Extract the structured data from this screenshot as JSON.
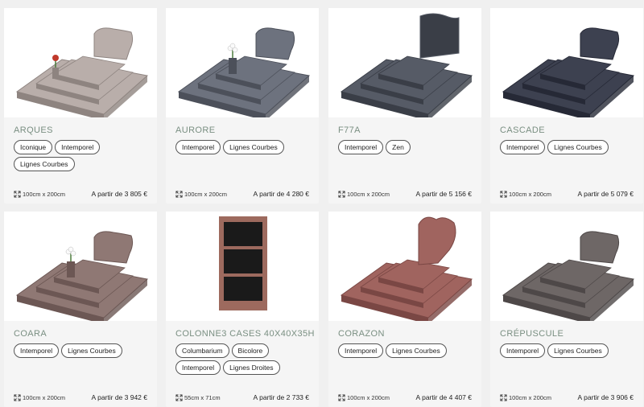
{
  "products": [
    {
      "name": "ARQUES",
      "tags": [
        "Iconique",
        "Intemporel",
        "Lignes Courbes"
      ],
      "dims": "100cm x 200cm",
      "price": "A partir de 3 805 €",
      "stone": "#b9aeaa",
      "stone_dark": "#8e8480",
      "stele": "heart",
      "decor": "rose"
    },
    {
      "name": "AURORE",
      "tags": [
        "Intemporel",
        "Lignes Courbes"
      ],
      "dims": "100cm x 200cm",
      "price": "A partir de 4 280 €",
      "stone": "#6d727e",
      "stone_dark": "#4c505a",
      "stele": "heart",
      "decor": "lily"
    },
    {
      "name": "F77A",
      "tags": [
        "Intemporel",
        "Zen"
      ],
      "dims": "100cm x 200cm",
      "price": "A partir de 5 156 €",
      "stone": "#565b66",
      "stone_dark": "#3a3e47",
      "stele": "wave",
      "decor": "none"
    },
    {
      "name": "CASCADE",
      "tags": [
        "Intemporel",
        "Lignes Courbes"
      ],
      "dims": "100cm x 200cm",
      "price": "A partir de 5 079 €",
      "stone": "#3d4150",
      "stone_dark": "#262936",
      "stele": "heart",
      "decor": "none"
    },
    {
      "name": "COARA",
      "tags": [
        "Intemporel",
        "Lignes Courbes"
      ],
      "dims": "100cm x 200cm",
      "price": "A partir de 3 942 €",
      "stone": "#8f7874",
      "stone_dark": "#6c5754",
      "stele": "heart",
      "decor": "lily"
    },
    {
      "name": "COLONNE3 CASES 40X40X35H",
      "tags": [
        "Columbarium",
        "Bicolore",
        "Intemporel",
        "Lignes Droites"
      ],
      "dims": "55cm x 71cm",
      "price": "A partir de 2 733 €",
      "stone": "#9d6a5e",
      "stone_dark": "#1a1a1a",
      "stele": "column",
      "decor": "none"
    },
    {
      "name": "CORAZON",
      "tags": [
        "Intemporel",
        "Lignes Courbes"
      ],
      "dims": "100cm x 200cm",
      "price": "A partir de 4 407 €",
      "stone": "#a0645f",
      "stone_dark": "#7a4744",
      "stele": "bigheart",
      "decor": "none"
    },
    {
      "name": "CRÉPUSCULE",
      "tags": [
        "Intemporel",
        "Lignes Courbes"
      ],
      "dims": "100cm x 200cm",
      "price": "A partir de 3 906 €",
      "stone": "#6e6766",
      "stone_dark": "#4e4848",
      "stele": "heart",
      "decor": "none"
    }
  ]
}
